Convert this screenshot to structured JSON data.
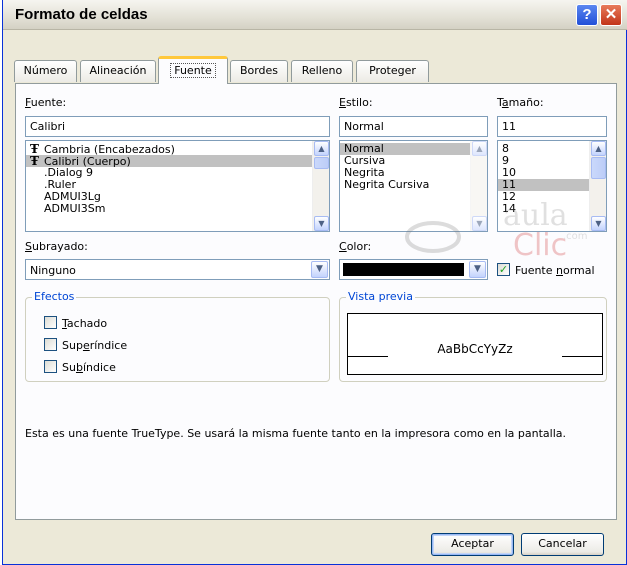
{
  "window": {
    "title": "Formato de celdas",
    "help_label": "?",
    "close_label": "✕"
  },
  "tabs": [
    {
      "label": "Número"
    },
    {
      "label": "Alineación"
    },
    {
      "label": "Fuente"
    },
    {
      "label": "Bordes"
    },
    {
      "label": "Relleno"
    },
    {
      "label": "Proteger"
    }
  ],
  "font": {
    "label_accel": "F",
    "label_rest": "uente:",
    "value": "Calibri",
    "items": [
      "Cambria (Encabezados)",
      "Calibri (Cuerpo)",
      ".Dialog 9",
      ".Ruler",
      "ADMUI3Lg",
      "ADMUI3Sm"
    ],
    "selected": "Calibri (Cuerpo)"
  },
  "style": {
    "label_accel": "E",
    "label_rest": "stilo:",
    "value": "Normal",
    "items": [
      "Normal",
      "Cursiva",
      "Negrita",
      "Negrita Cursiva"
    ]
  },
  "size": {
    "label_pre": "T",
    "label_accel": "a",
    "label_rest": "maño:",
    "value": "11",
    "items": [
      "8",
      "9",
      "10",
      "11",
      "12",
      "14"
    ]
  },
  "underline": {
    "label_accel": "S",
    "label_rest": "ubrayado:",
    "value": "Ninguno"
  },
  "color": {
    "label_accel": "C",
    "label_rest": "olor:",
    "swatch": "#000000"
  },
  "normal_font": {
    "label_pre": "Fuente ",
    "label_accel": "n",
    "label_rest": "ormal",
    "checked": true
  },
  "effects": {
    "title": "Efectos",
    "strike": {
      "label_accel": "T",
      "label_rest": "achado"
    },
    "super": {
      "label_pre": "Sup",
      "label_accel": "e",
      "label_rest": "ríndice"
    },
    "sub": {
      "label_pre": "Su",
      "label_accel": "b",
      "label_rest": "índice"
    }
  },
  "preview": {
    "title": "Vista previa",
    "sample": "AaBbCcYyZz"
  },
  "info": "Esta es una fuente TrueType. Se usará la misma fuente tanto en la impresora como en la pantalla.",
  "buttons": {
    "ok": "Aceptar",
    "cancel": "Cancelar"
  },
  "watermark": {
    "line1": "aula",
    "line2": "Clic",
    "line3": ".com"
  },
  "colors": {
    "title_text": "#000000",
    "group_label": "#0046d5",
    "selection": "#c1c1c1"
  }
}
